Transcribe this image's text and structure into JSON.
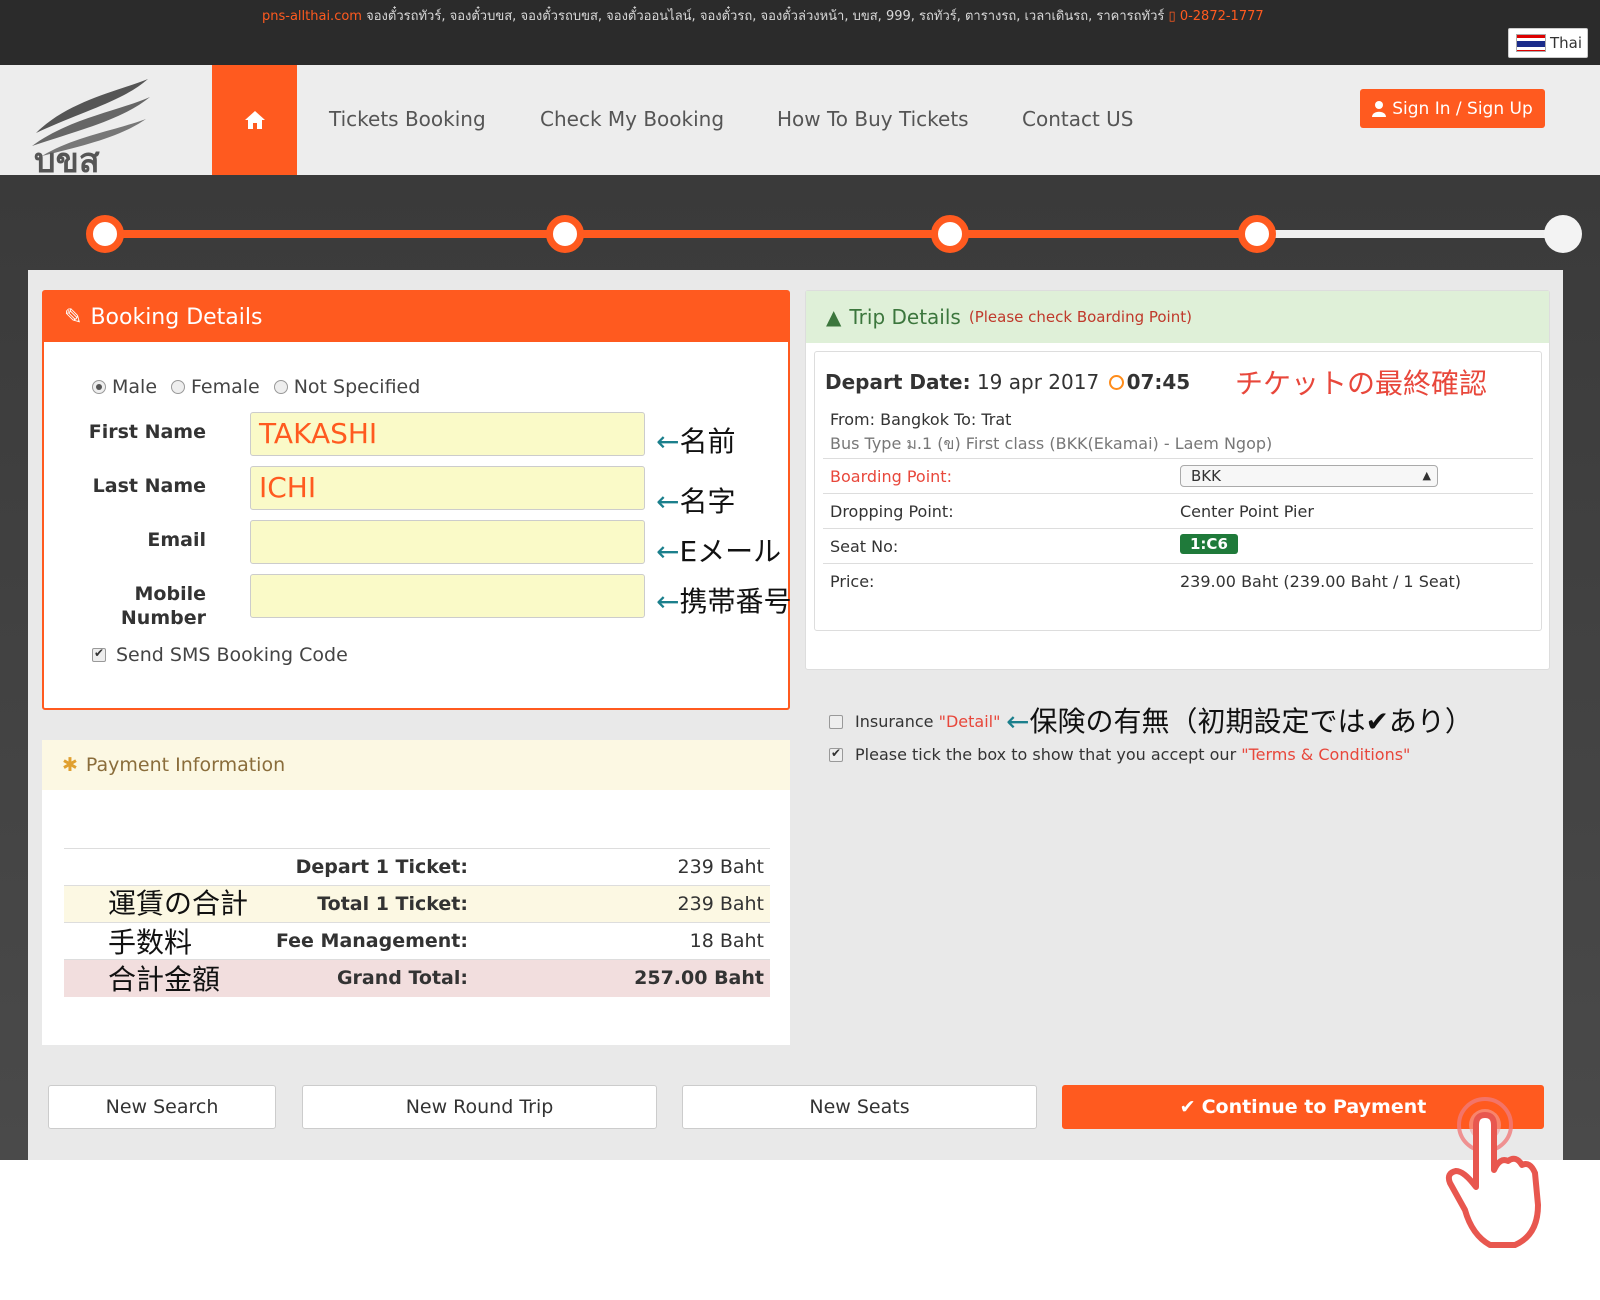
{
  "topbar": {
    "site": "pns-allthai.com",
    "keywords": "จองตั๋วรถทัวร์, จองตั๋วบขส, จองตั๋วรถบขส, จองตั๋วออนไลน์, จองตั๋วรถ, จองตั๋วล่วงหน้า, บขส, 999, รถทัวร์, ตารางรถ, เวลาเดินรถ, ราคารถทัวร์",
    "phone": "0-2872-1777",
    "language": "Thai"
  },
  "nav": {
    "logo_text": "บขส",
    "links": [
      "Tickets Booking",
      "Check My Booking",
      "How To Buy Tickets",
      "Contact US"
    ],
    "sign_in": "Sign In / Sign Up"
  },
  "progress": {
    "steps_total": 5,
    "current_step": 4
  },
  "booking": {
    "title": "Booking Details",
    "gender_options": [
      "Male",
      "Female",
      "Not Specified"
    ],
    "gender_selected": "Male",
    "first_name_label": "First Name",
    "first_name_value": "TAKASHI",
    "last_name_label": "Last Name",
    "last_name_value": "ICHI",
    "email_label": "Email",
    "email_value": "",
    "mobile_label_1": "Mobile",
    "mobile_label_2": "Number",
    "mobile_value": "",
    "sms_label": "Send SMS Booking Code",
    "sms_checked": true
  },
  "notes": {
    "arrow": "←",
    "first_name": "名前",
    "last_name": "名字",
    "email": "Eメール",
    "mobile": "携帯番号",
    "final_check": "チケットの最終確認",
    "insurance": "保険の有無（初期設定では✔あり）",
    "fare_total": "運賃の合計",
    "fee": "手数料",
    "grand_total": "合計金額"
  },
  "payment": {
    "title": "Payment Information",
    "rows": [
      {
        "label": "Depart 1 Ticket:",
        "value": "239 Baht"
      },
      {
        "label": "Total 1 Ticket:",
        "value": "239 Baht"
      },
      {
        "label": "Fee Management:",
        "value": "18 Baht"
      },
      {
        "label": "Grand Total:",
        "value": "257.00 Baht"
      }
    ]
  },
  "trip": {
    "title": "Trip Details",
    "subtitle": "(Please check Boarding Point)",
    "depart_label": "Depart Date:",
    "depart_date": "19 apr 2017",
    "depart_time": "07:45",
    "from_label": "From:",
    "from": "Bangkok",
    "to_label": "To:",
    "to": "Trat",
    "bus_type": "Bus Type ม.1 (ข) First class (BKK(Ekamai) - Laem Ngop)",
    "boarding_label": "Boarding Point:",
    "boarding_value": "BKK",
    "dropping_label": "Dropping Point:",
    "dropping_value": "Center Point Pier",
    "seat_label": "Seat No:",
    "seat_value": "1:C6",
    "price_label": "Price:",
    "price_value": "239.00 Baht (239.00 Baht / 1 Seat)"
  },
  "options": {
    "insurance_label": "Insurance",
    "insurance_link": "\"Detail\"",
    "insurance_checked": false,
    "terms_label": "Please tick the box to show that you accept our",
    "terms_link": "\"Terms & Conditions\"",
    "terms_checked": true
  },
  "buttons": {
    "new_search": "New Search",
    "new_round_trip": "New Round Trip",
    "new_seats": "New Seats",
    "continue": "Continue to Payment"
  },
  "colors": {
    "accent": "#ff5a1f",
    "success": "#1f7a3a",
    "note_red": "#e8473b"
  }
}
